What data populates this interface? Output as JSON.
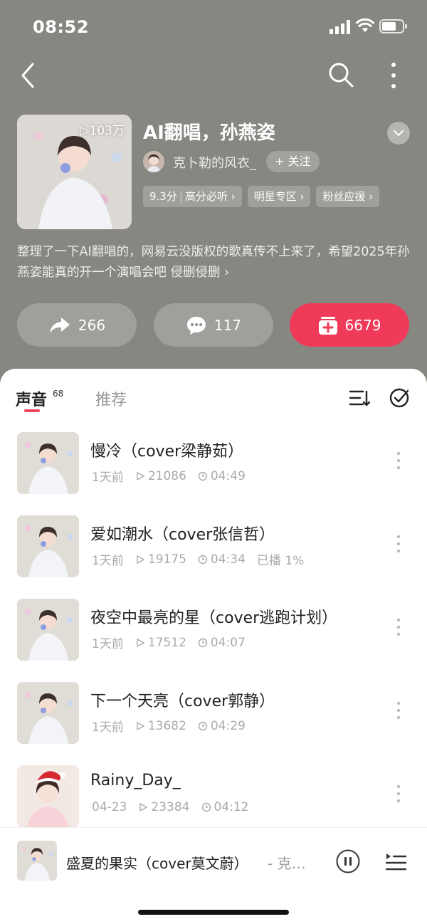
{
  "status": {
    "time": "08:52",
    "icons": [
      "cellular-signal-icon",
      "wifi-icon",
      "battery-icon"
    ]
  },
  "nav": {
    "icons": [
      "back-chevron-icon",
      "search-icon",
      "more-vertical-icon"
    ]
  },
  "playlist": {
    "play_count": "▷103万",
    "title": "AI翻唱，孙燕姿",
    "creator_name": "克卜勒的风衣_",
    "follow_label": "+ 关注",
    "tags": [
      {
        "score": "9.3分",
        "label": "高分必听 ›"
      },
      {
        "label": "明星专区 ›"
      },
      {
        "label": "粉丝应援 ›"
      }
    ],
    "description": "整理了一下AI翻唱的，网易云没版权的歌真传不上来了，希望2025年孙燕姿能真的开一个演唱会吧 侵删侵删 ›"
  },
  "actions": {
    "share_count": "266",
    "comment_count": "117",
    "collect_count": "6679",
    "collect_color": "#f03a5a"
  },
  "tabs": {
    "voice_label": "声音",
    "voice_count": "68",
    "recommend_label": "推荐",
    "accent": "#f0435c"
  },
  "tracks": [
    {
      "title": "慢冷（cover梁静茹）",
      "date": "1天前",
      "plays": "21086",
      "duration": "04:49",
      "extra": ""
    },
    {
      "title": "爱如潮水（cover张信哲）",
      "date": "1天前",
      "plays": "19175",
      "duration": "04:34",
      "extra": "已播 1%"
    },
    {
      "title": "夜空中最亮的星（cover逃跑计划）",
      "date": "1天前",
      "plays": "17512",
      "duration": "04:07",
      "extra": ""
    },
    {
      "title": "下一个天亮（cover郭静）",
      "date": "1天前",
      "plays": "13682",
      "duration": "04:29",
      "extra": ""
    },
    {
      "title": "Rainy_Day_",
      "date": "04-23",
      "plays": "23384",
      "duration": "04:12",
      "extra": ""
    }
  ],
  "player": {
    "title": "盛夏的果实（cover莫文蔚）",
    "artist": "- 克…"
  }
}
